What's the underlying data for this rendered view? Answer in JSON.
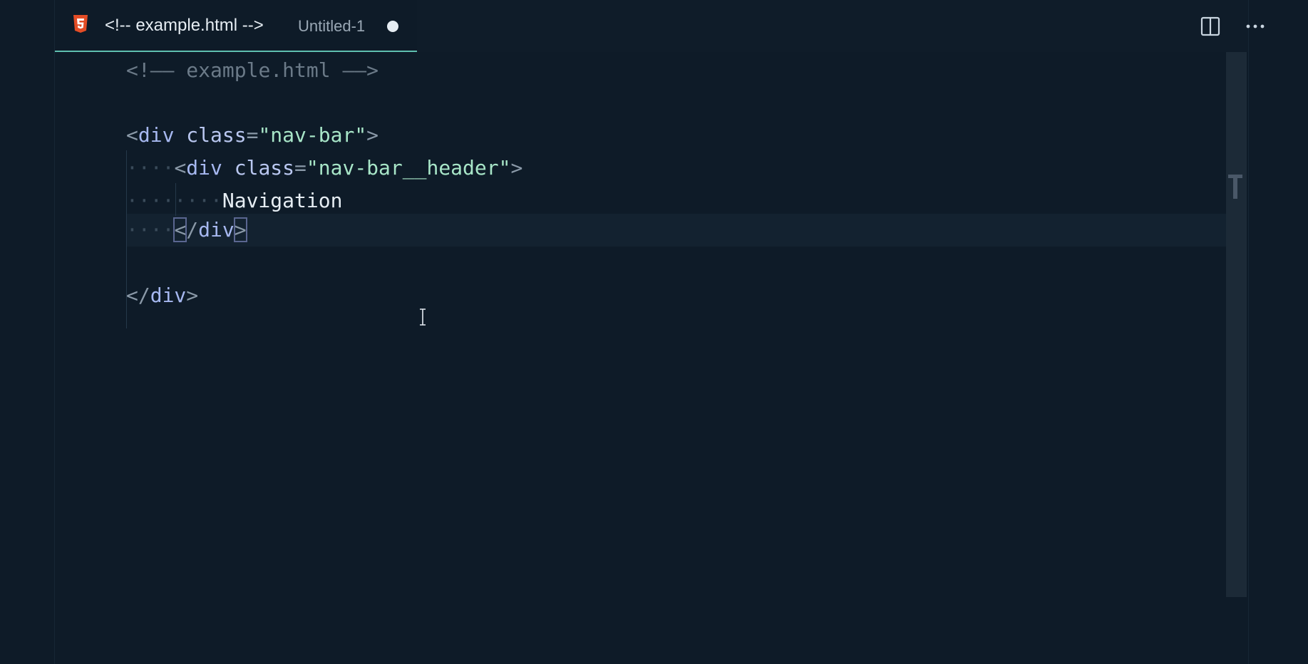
{
  "tab": {
    "icon": "html5-icon",
    "title": "<!-- example.html -->",
    "description": "Untitled-1",
    "dirty_indicator": "unsaved-dot"
  },
  "actions": {
    "split_editor_icon": "split-editor-icon",
    "more_actions_icon": "more-actions-icon"
  },
  "editor": {
    "lines": {
      "l1": {
        "comment_open": "<!——",
        "comment_text": " example.html ",
        "comment_close": "——>"
      },
      "l3": {
        "open": "<",
        "tag": "div",
        "attr": " class",
        "eq": "=",
        "value": "\"nav-bar\"",
        "close": ">"
      },
      "l4": {
        "indent": "····",
        "open": "<",
        "tag": "div",
        "attr": " class",
        "eq": "=",
        "value": "\"nav-bar__header\"",
        "close": ">"
      },
      "l5": {
        "indent": "········",
        "text": "Navigation"
      },
      "l6": {
        "indent": "····",
        "open": "<",
        "slash": "/",
        "tag": "div",
        "close": ">"
      },
      "l8": {
        "open": "<",
        "slash": "/",
        "tag": "div",
        "close": ">"
      }
    }
  },
  "colors": {
    "background": "#0e1b28",
    "tab_accent": "#5fbfb0",
    "html_icon": "#e44d26",
    "string": "#a8e6c8",
    "tag": "#a6b8f0"
  }
}
